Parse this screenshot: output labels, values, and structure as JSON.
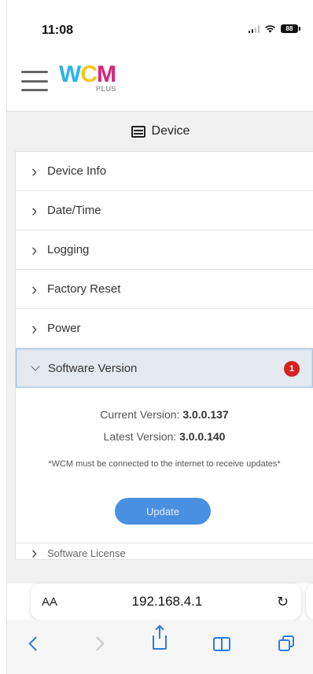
{
  "status": {
    "time": "11:08",
    "battery": "88"
  },
  "header": {
    "logo_w": "W",
    "logo_c": "C",
    "logo_m": "M",
    "logo_sub": "PLUS"
  },
  "panel": {
    "title": "Device",
    "items": [
      {
        "label": "Device Info"
      },
      {
        "label": "Date/Time"
      },
      {
        "label": "Logging"
      },
      {
        "label": "Factory Reset"
      },
      {
        "label": "Power"
      }
    ],
    "open_item": {
      "label": "Software Version",
      "badge": "1",
      "current_label": "Current Version:",
      "current_value": "3.0.0.137",
      "latest_label": "Latest Version:",
      "latest_value": "3.0.0.140",
      "note": "*WCM must be connected to the internet to receive updates*",
      "update_label": "Update"
    },
    "next_item": "Software License"
  },
  "browser": {
    "aa": "AA",
    "url": "192.168.4.1",
    "reload": "↻"
  }
}
